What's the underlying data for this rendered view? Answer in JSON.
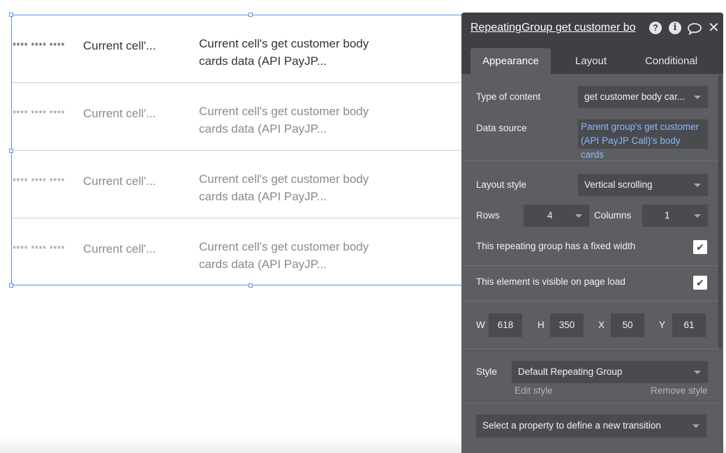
{
  "canvas": {
    "rows": [
      {
        "mask": "**** ****  ****",
        "cell1": "Current cell'...",
        "cell2": "Current cell's get customer body cards data (API PayJP..."
      },
      {
        "mask": "**** ****  ****",
        "cell1": "Current cell'...",
        "cell2": "Current cell's get customer body cards data (API PayJP..."
      },
      {
        "mask": "**** ****  ****",
        "cell1": "Current cell'...",
        "cell2": "Current cell's get customer body cards data (API PayJP..."
      },
      {
        "mask": "**** ****  ****",
        "cell1": "Current cell'...",
        "cell2": "Current cell's get customer body cards data (API PayJP..."
      }
    ]
  },
  "panel": {
    "title": "RepeatingGroup get customer bo",
    "header_icons": [
      "help-icon",
      "info-icon",
      "comment-icon",
      "close-icon"
    ],
    "tabs": [
      "Appearance",
      "Layout",
      "Conditional"
    ],
    "type_of_content": {
      "label": "Type of content",
      "value": "get customer body car..."
    },
    "data_source": {
      "label": "Data source",
      "value": "Parent group's get customer (API PayJP Call)'s body cards"
    },
    "layout_style": {
      "label": "Layout style",
      "value": "Vertical scrolling"
    },
    "rows": {
      "label": "Rows",
      "value": "4"
    },
    "columns": {
      "label": "Columns",
      "value": "1"
    },
    "fixed_width": {
      "label": "This repeating group has a fixed width",
      "checked": true
    },
    "visible": {
      "label": "This element is visible on page load",
      "checked": true
    },
    "dims": {
      "w_label": "W",
      "w": "618",
      "h_label": "H",
      "h": "350",
      "x_label": "X",
      "x": "50",
      "y_label": "Y",
      "y": "61"
    },
    "style": {
      "label": "Style",
      "value": "Default Repeating Group",
      "edit": "Edit style",
      "remove": "Remove style"
    },
    "transition": {
      "placeholder": "Select a property to define a new transition"
    },
    "check_glyph": "✔"
  }
}
